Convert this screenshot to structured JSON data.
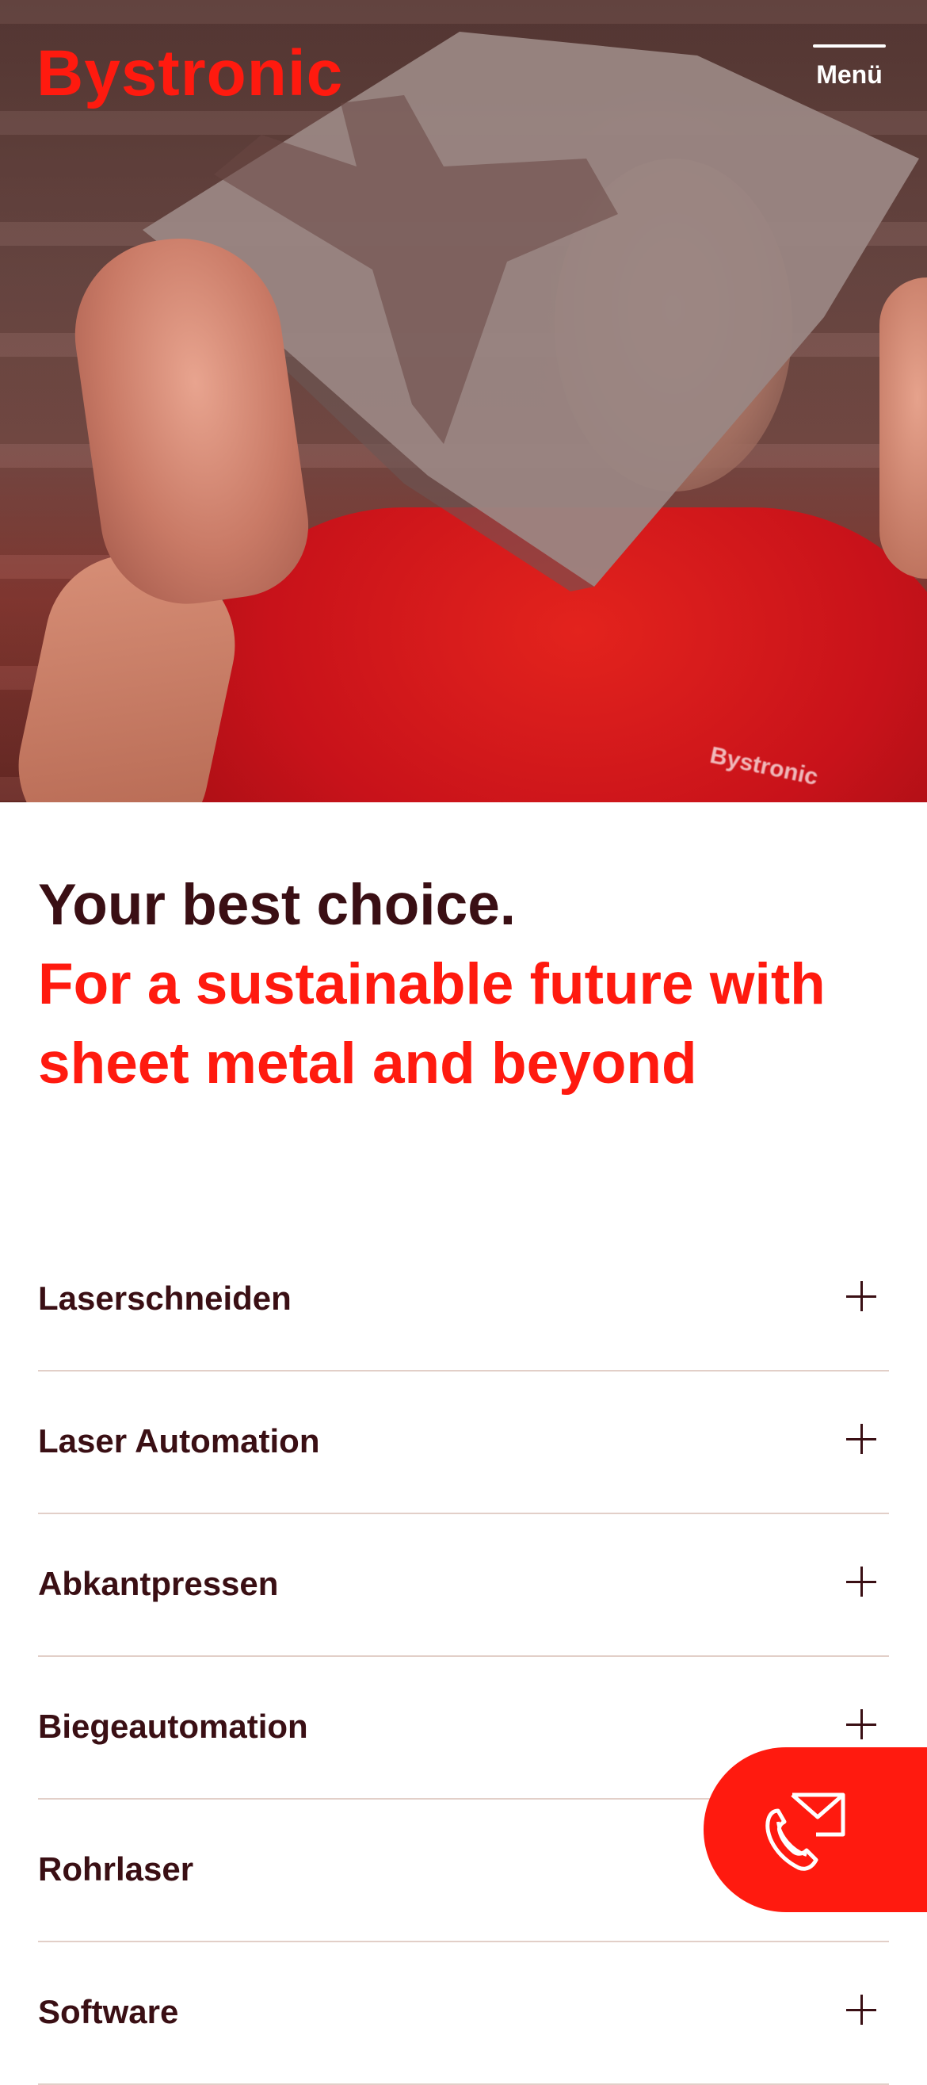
{
  "header": {
    "logo_text": "Bystronic",
    "menu_label": "Menü"
  },
  "hero": {
    "shirt_logo_text": "Bystronic"
  },
  "headline": {
    "line_dark": "Your best choice.",
    "line_red": "For a sustainable future with sheet metal and beyond"
  },
  "categories": [
    {
      "label": "Laserschneiden",
      "icon": "plus-icon"
    },
    {
      "label": "Laser Automation",
      "icon": "plus-icon"
    },
    {
      "label": "Abkantpressen",
      "icon": "plus-icon"
    },
    {
      "label": "Biegeautomation",
      "icon": "plus-icon"
    },
    {
      "label": "Rohrlaser",
      "icon": "plus-icon"
    },
    {
      "label": "Software",
      "icon": "plus-icon"
    }
  ],
  "contact_button": {
    "icon": "phone-mail-icon"
  },
  "colors": {
    "brand_red": "#ff1a0f",
    "text_dark": "#3a0f14",
    "divider": "#e2cfc8"
  }
}
